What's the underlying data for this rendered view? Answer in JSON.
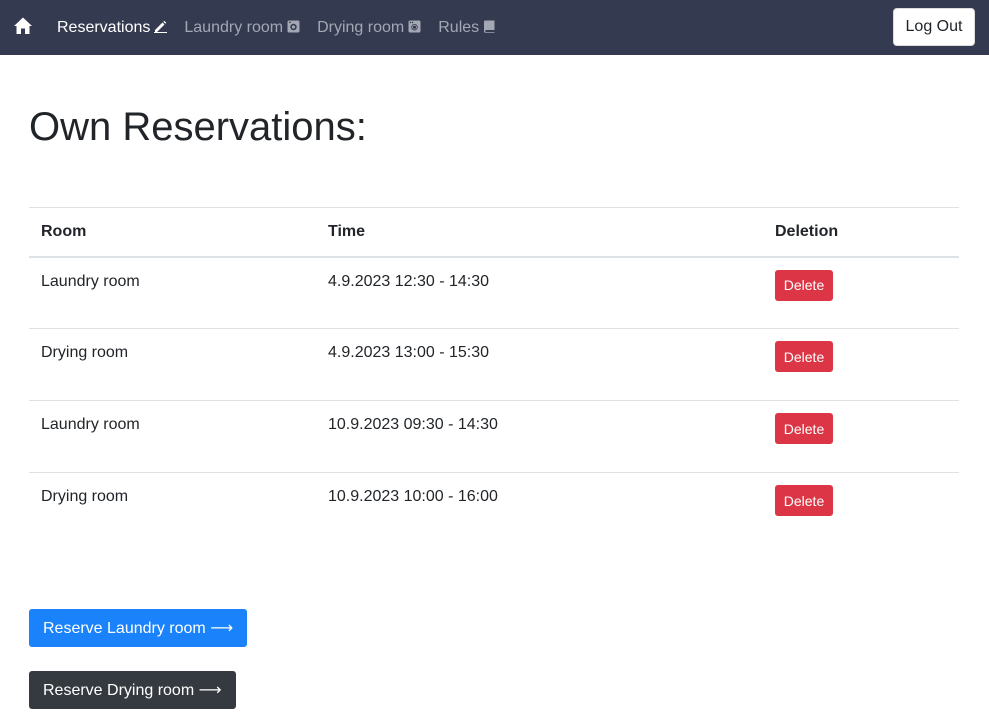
{
  "nav": {
    "home_icon": "home-icon",
    "links": [
      {
        "label": "Reservations",
        "icon": "pencil-icon",
        "active": true
      },
      {
        "label": "Laundry room",
        "icon": "washing-machine-icon",
        "active": false
      },
      {
        "label": "Drying room",
        "icon": "dryer-icon",
        "active": false
      },
      {
        "label": "Rules",
        "icon": "book-icon",
        "active": false
      }
    ],
    "logout_label": "Log Out"
  },
  "page": {
    "title": "Own Reservations:"
  },
  "table": {
    "headers": {
      "room": "Room",
      "time": "Time",
      "deletion": "Deletion"
    },
    "rows": [
      {
        "room": "Laundry room",
        "time": "4.9.2023 12:30 - 14:30",
        "action": "Delete"
      },
      {
        "room": "Drying room",
        "time": "4.9.2023 13:00 - 15:30",
        "action": "Delete"
      },
      {
        "room": "Laundry room",
        "time": "10.9.2023 09:30 - 14:30",
        "action": "Delete"
      },
      {
        "room": "Drying room",
        "time": "10.9.2023 10:00 - 16:00",
        "action": "Delete"
      }
    ]
  },
  "actions": {
    "reserve_laundry": "Reserve Laundry room ⟶",
    "reserve_drying": "Reserve Drying room ⟶"
  },
  "colors": {
    "navbar": "#343a4f",
    "primary": "#1a82fb",
    "danger": "#dc3545",
    "dark": "#343a40"
  }
}
